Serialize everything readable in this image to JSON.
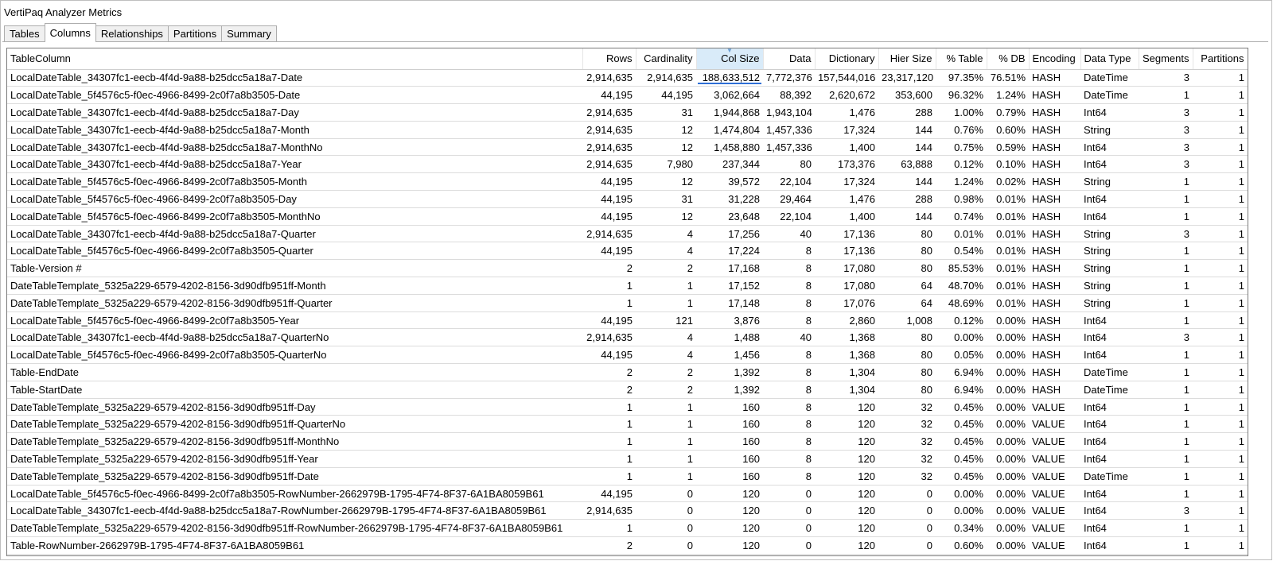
{
  "window_title": "VertiPaq Analyzer Metrics",
  "tabs": [
    "Tables",
    "Columns",
    "Relationships",
    "Partitions",
    "Summary"
  ],
  "active_tab": "Columns",
  "columns": [
    "TableColumn",
    "Rows",
    "Cardinality",
    "Col Size",
    "Data",
    "Dictionary",
    "Hier Size",
    "% Table",
    "% DB",
    "Encoding",
    "Data Type",
    "Segments",
    "Partitions"
  ],
  "sorted_column": "Col Size",
  "rows": [
    [
      "LocalDateTable_34307fc1-eecb-4f4d-9a88-b25dcc5a18a7-Date",
      "2,914,635",
      "2,914,635",
      "188,633,512",
      "7,772,376",
      "157,544,016",
      "23,317,120",
      "97.35%",
      "76.51%",
      "HASH",
      "DateTime",
      "3",
      "1"
    ],
    [
      "LocalDateTable_5f4576c5-f0ec-4966-8499-2c0f7a8b3505-Date",
      "44,195",
      "44,195",
      "3,062,664",
      "88,392",
      "2,620,672",
      "353,600",
      "96.32%",
      "1.24%",
      "HASH",
      "DateTime",
      "1",
      "1"
    ],
    [
      "LocalDateTable_34307fc1-eecb-4f4d-9a88-b25dcc5a18a7-Day",
      "2,914,635",
      "31",
      "1,944,868",
      "1,943,104",
      "1,476",
      "288",
      "1.00%",
      "0.79%",
      "HASH",
      "Int64",
      "3",
      "1"
    ],
    [
      "LocalDateTable_34307fc1-eecb-4f4d-9a88-b25dcc5a18a7-Month",
      "2,914,635",
      "12",
      "1,474,804",
      "1,457,336",
      "17,324",
      "144",
      "0.76%",
      "0.60%",
      "HASH",
      "String",
      "3",
      "1"
    ],
    [
      "LocalDateTable_34307fc1-eecb-4f4d-9a88-b25dcc5a18a7-MonthNo",
      "2,914,635",
      "12",
      "1,458,880",
      "1,457,336",
      "1,400",
      "144",
      "0.75%",
      "0.59%",
      "HASH",
      "Int64",
      "3",
      "1"
    ],
    [
      "LocalDateTable_34307fc1-eecb-4f4d-9a88-b25dcc5a18a7-Year",
      "2,914,635",
      "7,980",
      "237,344",
      "80",
      "173,376",
      "63,888",
      "0.12%",
      "0.10%",
      "HASH",
      "Int64",
      "3",
      "1"
    ],
    [
      "LocalDateTable_5f4576c5-f0ec-4966-8499-2c0f7a8b3505-Month",
      "44,195",
      "12",
      "39,572",
      "22,104",
      "17,324",
      "144",
      "1.24%",
      "0.02%",
      "HASH",
      "String",
      "1",
      "1"
    ],
    [
      "LocalDateTable_5f4576c5-f0ec-4966-8499-2c0f7a8b3505-Day",
      "44,195",
      "31",
      "31,228",
      "29,464",
      "1,476",
      "288",
      "0.98%",
      "0.01%",
      "HASH",
      "Int64",
      "1",
      "1"
    ],
    [
      "LocalDateTable_5f4576c5-f0ec-4966-8499-2c0f7a8b3505-MonthNo",
      "44,195",
      "12",
      "23,648",
      "22,104",
      "1,400",
      "144",
      "0.74%",
      "0.01%",
      "HASH",
      "Int64",
      "1",
      "1"
    ],
    [
      "LocalDateTable_34307fc1-eecb-4f4d-9a88-b25dcc5a18a7-Quarter",
      "2,914,635",
      "4",
      "17,256",
      "40",
      "17,136",
      "80",
      "0.01%",
      "0.01%",
      "HASH",
      "String",
      "3",
      "1"
    ],
    [
      "LocalDateTable_5f4576c5-f0ec-4966-8499-2c0f7a8b3505-Quarter",
      "44,195",
      "4",
      "17,224",
      "8",
      "17,136",
      "80",
      "0.54%",
      "0.01%",
      "HASH",
      "String",
      "1",
      "1"
    ],
    [
      "Table-Version #",
      "2",
      "2",
      "17,168",
      "8",
      "17,080",
      "80",
      "85.53%",
      "0.01%",
      "HASH",
      "String",
      "1",
      "1"
    ],
    [
      "DateTableTemplate_5325a229-6579-4202-8156-3d90dfb951ff-Month",
      "1",
      "1",
      "17,152",
      "8",
      "17,080",
      "64",
      "48.70%",
      "0.01%",
      "HASH",
      "String",
      "1",
      "1"
    ],
    [
      "DateTableTemplate_5325a229-6579-4202-8156-3d90dfb951ff-Quarter",
      "1",
      "1",
      "17,148",
      "8",
      "17,076",
      "64",
      "48.69%",
      "0.01%",
      "HASH",
      "String",
      "1",
      "1"
    ],
    [
      "LocalDateTable_5f4576c5-f0ec-4966-8499-2c0f7a8b3505-Year",
      "44,195",
      "121",
      "3,876",
      "8",
      "2,860",
      "1,008",
      "0.12%",
      "0.00%",
      "HASH",
      "Int64",
      "1",
      "1"
    ],
    [
      "LocalDateTable_34307fc1-eecb-4f4d-9a88-b25dcc5a18a7-QuarterNo",
      "2,914,635",
      "4",
      "1,488",
      "40",
      "1,368",
      "80",
      "0.00%",
      "0.00%",
      "HASH",
      "Int64",
      "3",
      "1"
    ],
    [
      "LocalDateTable_5f4576c5-f0ec-4966-8499-2c0f7a8b3505-QuarterNo",
      "44,195",
      "4",
      "1,456",
      "8",
      "1,368",
      "80",
      "0.05%",
      "0.00%",
      "HASH",
      "Int64",
      "1",
      "1"
    ],
    [
      "Table-EndDate",
      "2",
      "2",
      "1,392",
      "8",
      "1,304",
      "80",
      "6.94%",
      "0.00%",
      "HASH",
      "DateTime",
      "1",
      "1"
    ],
    [
      "Table-StartDate",
      "2",
      "2",
      "1,392",
      "8",
      "1,304",
      "80",
      "6.94%",
      "0.00%",
      "HASH",
      "DateTime",
      "1",
      "1"
    ],
    [
      "DateTableTemplate_5325a229-6579-4202-8156-3d90dfb951ff-Day",
      "1",
      "1",
      "160",
      "8",
      "120",
      "32",
      "0.45%",
      "0.00%",
      "VALUE",
      "Int64",
      "1",
      "1"
    ],
    [
      "DateTableTemplate_5325a229-6579-4202-8156-3d90dfb951ff-QuarterNo",
      "1",
      "1",
      "160",
      "8",
      "120",
      "32",
      "0.45%",
      "0.00%",
      "VALUE",
      "Int64",
      "1",
      "1"
    ],
    [
      "DateTableTemplate_5325a229-6579-4202-8156-3d90dfb951ff-MonthNo",
      "1",
      "1",
      "160",
      "8",
      "120",
      "32",
      "0.45%",
      "0.00%",
      "VALUE",
      "Int64",
      "1",
      "1"
    ],
    [
      "DateTableTemplate_5325a229-6579-4202-8156-3d90dfb951ff-Year",
      "1",
      "1",
      "160",
      "8",
      "120",
      "32",
      "0.45%",
      "0.00%",
      "VALUE",
      "Int64",
      "1",
      "1"
    ],
    [
      "DateTableTemplate_5325a229-6579-4202-8156-3d90dfb951ff-Date",
      "1",
      "1",
      "160",
      "8",
      "120",
      "32",
      "0.45%",
      "0.00%",
      "VALUE",
      "DateTime",
      "1",
      "1"
    ],
    [
      "LocalDateTable_5f4576c5-f0ec-4966-8499-2c0f7a8b3505-RowNumber-2662979B-1795-4F74-8F37-6A1BA8059B61",
      "44,195",
      "0",
      "120",
      "0",
      "120",
      "0",
      "0.00%",
      "0.00%",
      "VALUE",
      "Int64",
      "1",
      "1"
    ],
    [
      "LocalDateTable_34307fc1-eecb-4f4d-9a88-b25dcc5a18a7-RowNumber-2662979B-1795-4F74-8F37-6A1BA8059B61",
      "2,914,635",
      "0",
      "120",
      "0",
      "120",
      "0",
      "0.00%",
      "0.00%",
      "VALUE",
      "Int64",
      "3",
      "1"
    ],
    [
      "DateTableTemplate_5325a229-6579-4202-8156-3d90dfb951ff-RowNumber-2662979B-1795-4F74-8F37-6A1BA8059B61",
      "1",
      "0",
      "120",
      "0",
      "120",
      "0",
      "0.34%",
      "0.00%",
      "VALUE",
      "Int64",
      "1",
      "1"
    ],
    [
      "Table-RowNumber-2662979B-1795-4F74-8F37-6A1BA8059B61",
      "2",
      "0",
      "120",
      "0",
      "120",
      "0",
      "0.60%",
      "0.00%",
      "VALUE",
      "Int64",
      "1",
      "1"
    ]
  ]
}
